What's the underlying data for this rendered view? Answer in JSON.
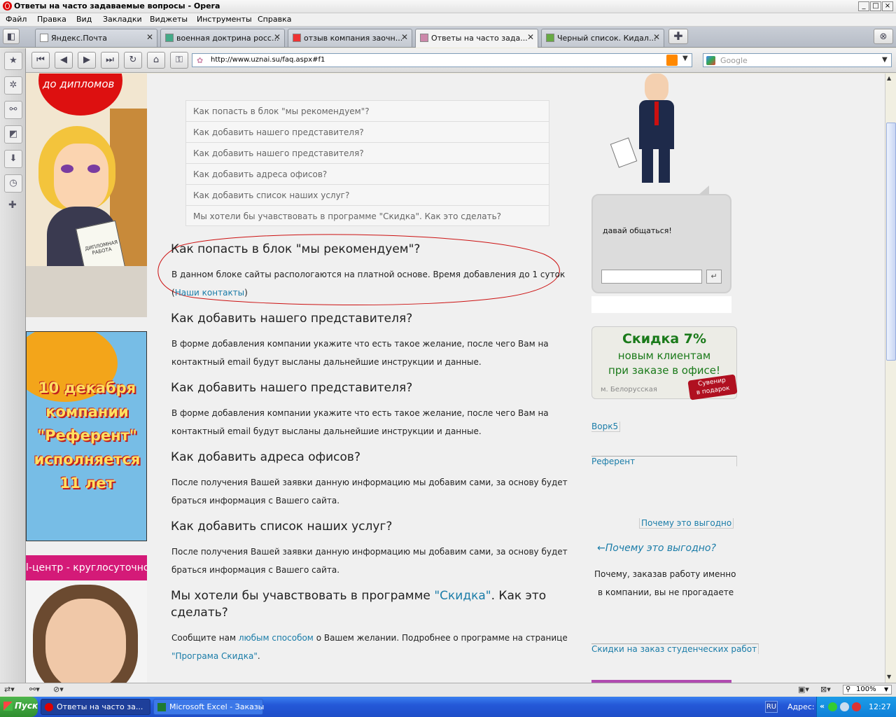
{
  "window": {
    "title": "Ответы на часто задаваемые вопросы - Opera",
    "controls": [
      "_",
      "□",
      "×"
    ]
  },
  "menu": [
    "Файл",
    "Правка",
    "Вид",
    "Закладки",
    "Виджеты",
    "Инструменты",
    "Справка"
  ],
  "tabs": [
    {
      "label": "Яндекс.Почта",
      "active": false
    },
    {
      "label": "военная доктрина росс...",
      "active": false
    },
    {
      "label": "отзыв компания заочн...",
      "active": false
    },
    {
      "label": "Ответы на часто зада...",
      "active": true
    },
    {
      "label": "Черный список. Кидал...",
      "active": false
    }
  ],
  "toolbar": {
    "address": "http://www.uznai.su/faq.aspx#f1",
    "search_placeholder": "Google"
  },
  "banners": {
    "top_text": "до дипломов",
    "folder_text": "ДИПЛОМНАЯ РАБОТА",
    "b2_lines": [
      "10 декабря",
      "компании",
      "\"Референт\"",
      "исполняется",
      "11 лет"
    ],
    "b3_text": "l-центр - круглосуточно!"
  },
  "faq": {
    "index": [
      "Как попасть в блок \"мы рекомендуем\"?",
      "Как добавить нашего представителя?",
      "Как добавить нашего представителя?",
      "Как добавить адреса офисов?",
      "Как добавить список наших услуг?",
      "Мы хотели бы учавствовать в программе \"Скидка\". Как это сделать?"
    ],
    "q1": {
      "title": "Как попасть в блок \"мы рекомендуем\"?",
      "text": "В данном блоке сайты распологаются на платной основе. Время добавления до 1 суток",
      "paren_open": "(",
      "link": "Наши контакты",
      "paren_close": ")"
    },
    "q2": {
      "title": "Как добавить нашего представителя?",
      "line1": "В форме добавления компании укажите что есть такое желание, после чего Вам на",
      "line2": "контактный email будут высланы дальнейшие инструкции и данные."
    },
    "q3": {
      "title": "Как добавить нашего представителя?",
      "line1": "В форме добавления компании укажите что есть такое желание, после чего Вам на",
      "line2": "контактный email будут высланы дальнейшие инструкции и данные."
    },
    "q4": {
      "title": "Как добавить адреса офисов?",
      "line1": "После получения Вашей заявки данную информацию мы добавим сами, за основу будет",
      "line2": "браться информация с Вашего сайта."
    },
    "q5": {
      "title": "Как добавить список наших услуг?",
      "line1": "После получения Вашей заявки данную информацию мы добавим сами, за основу будет",
      "line2": "браться информация с Вашего сайта."
    },
    "q6": {
      "title_a": "Мы хотели бы учавствовать в программе ",
      "title_link": "\"Скидка\"",
      "title_b": ". Как это",
      "title_c": "сделать?",
      "l1a": "Сообщите нам ",
      "l1link": "любым способом",
      "l1b": " о Вашем желании. Подробнее о программе на странице",
      "l2link": "\"Програма Скидка\"",
      "l2b": "."
    }
  },
  "right": {
    "chat_text": "давай общаться!",
    "chat_send": "↵",
    "discount": {
      "title": "Скидка 7%",
      "line1": "новым клиентам",
      "line2": "при заказе в офисе!",
      "metro": "м. Белорусская",
      "tag1": "Сувенир",
      "tag2": "в подарок"
    },
    "link1": "Ворк5",
    "link2": "Референт",
    "link3": "Почему это выгодно",
    "why_title": "←Почему это выгодно?",
    "why_l1": "Почему, заказав работу именно",
    "why_l2": "в компании, вы не прогадаете",
    "link4": "Скидки на заказ студенческих работ"
  },
  "statusbar": {
    "zoom": "100%"
  },
  "taskbar": {
    "start": "Пуск",
    "items": [
      "Ответы на часто за...",
      "Microsoft Excel - Заказы"
    ],
    "lang": "RU",
    "addr_label": "Адрес:",
    "chevrons": "«",
    "clock": "12:27"
  },
  "colors": {
    "link": "#1a7ca8",
    "annotation": "#cc1111",
    "discount_green": "#1a7a1a",
    "taskbar_blue": "#2458d8"
  }
}
